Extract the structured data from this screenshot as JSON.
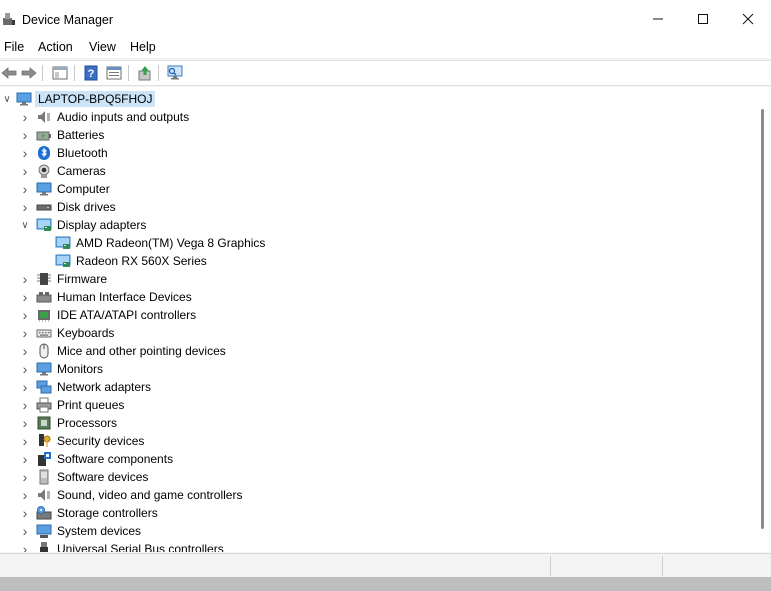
{
  "window": {
    "title": "Device Manager"
  },
  "menu": [
    "File",
    "Action",
    "View",
    "Help"
  ],
  "tree": {
    "root": "LAPTOP-BPQ5FHOJ",
    "categories": [
      {
        "label": "Audio inputs and outputs",
        "icon": "speaker-icon"
      },
      {
        "label": "Batteries",
        "icon": "battery-icon"
      },
      {
        "label": "Bluetooth",
        "icon": "bluetooth-icon"
      },
      {
        "label": "Cameras",
        "icon": "camera-icon"
      },
      {
        "label": "Computer",
        "icon": "monitor-icon"
      },
      {
        "label": "Disk drives",
        "icon": "disk-drive-icon"
      },
      {
        "label": "Display adapters",
        "icon": "display-adapter-icon",
        "expanded": true
      },
      {
        "label": "AMD Radeon(TM) Vega 8 Graphics",
        "icon": "display-adapter-icon",
        "child": true
      },
      {
        "label": "Radeon RX 560X Series",
        "icon": "display-adapter-icon",
        "child": true
      },
      {
        "label": "Firmware",
        "icon": "chip-icon"
      },
      {
        "label": "Human Interface Devices",
        "icon": "hid-icon"
      },
      {
        "label": "IDE ATA/ATAPI controllers",
        "icon": "controller-icon"
      },
      {
        "label": "Keyboards",
        "icon": "keyboard-icon"
      },
      {
        "label": "Mice and other pointing devices",
        "icon": "mouse-icon"
      },
      {
        "label": "Monitors",
        "icon": "monitor-icon"
      },
      {
        "label": "Network adapters",
        "icon": "network-icon"
      },
      {
        "label": "Print queues",
        "icon": "printer-icon"
      },
      {
        "label": "Processors",
        "icon": "processor-icon"
      },
      {
        "label": "Security devices",
        "icon": "security-key-icon"
      },
      {
        "label": "Software components",
        "icon": "software-component-icon"
      },
      {
        "label": "Software devices",
        "icon": "software-device-icon"
      },
      {
        "label": "Sound, video and game controllers",
        "icon": "speaker-icon"
      },
      {
        "label": "Storage controllers",
        "icon": "storage-icon"
      },
      {
        "label": "System devices",
        "icon": "system-icon"
      },
      {
        "label": "Universal Serial Bus controllers",
        "icon": "usb-icon"
      }
    ]
  },
  "colors": {
    "selection": "#cce4f7",
    "accent": "#0078d4"
  }
}
